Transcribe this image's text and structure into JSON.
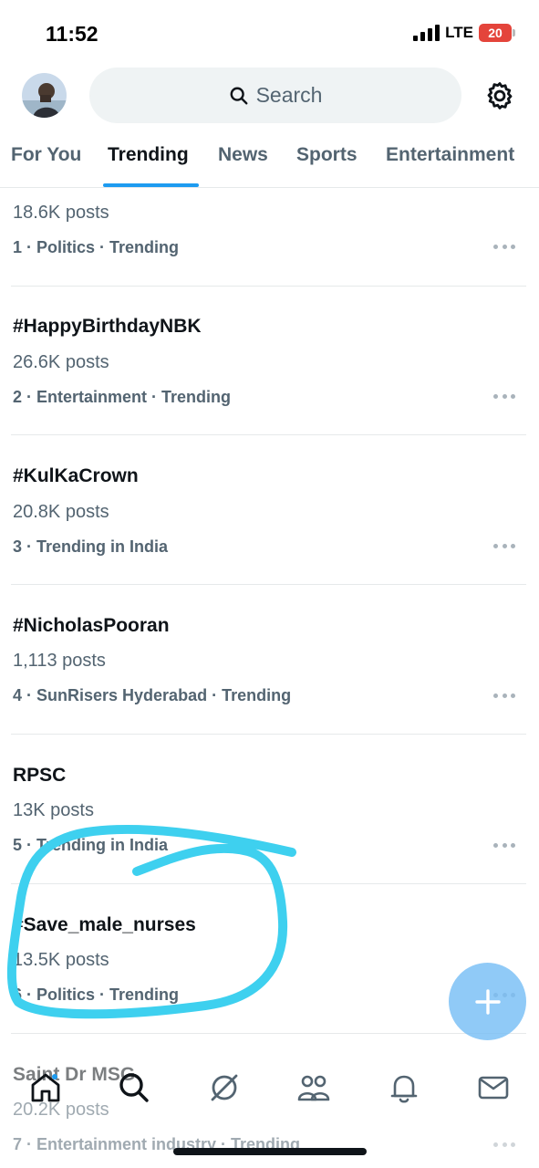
{
  "status_bar": {
    "time": "11:52",
    "network": "LTE",
    "battery": "20"
  },
  "header": {
    "avatar_icon": "user-avatar",
    "search_placeholder": "Search",
    "search_icon": "search-icon",
    "settings_icon": "gear-icon"
  },
  "tabs": [
    {
      "label": "For You",
      "active": false
    },
    {
      "label": "Trending",
      "active": true
    },
    {
      "label": "News",
      "active": false
    },
    {
      "label": "Sports",
      "active": false
    },
    {
      "label": "Entertainment",
      "active": false
    }
  ],
  "trends": [
    {
      "name": "",
      "posts": "18.6K posts",
      "meta": "1 · Politics · Trending"
    },
    {
      "name": "#HappyBirthdayNBK",
      "posts": "26.6K posts",
      "meta": "2 · Entertainment · Trending"
    },
    {
      "name": "#KulKaCrown",
      "posts": "20.8K posts",
      "meta": "3 · Trending in India"
    },
    {
      "name": "#NicholasPooran",
      "posts": "1,113 posts",
      "meta": "4 · SunRisers Hyderabad · Trending"
    },
    {
      "name": "RPSC",
      "posts": "13K posts",
      "meta": "5 · Trending in India"
    },
    {
      "name": "#Save_male_nurses",
      "posts": "13.5K posts",
      "meta": "6 · Politics · Trending"
    },
    {
      "name": "Saint Dr MSG",
      "posts": "20.2K posts",
      "meta": "7 · Entertainment industry · Trending"
    }
  ],
  "bottom_nav": [
    "home-icon",
    "search-icon",
    "grok-icon",
    "communities-icon",
    "notifications-bell-icon",
    "messages-icon"
  ],
  "fab": {
    "icon": "compose-plus-icon"
  },
  "colors": {
    "accent": "#1d9bf0",
    "annotation": "#3ed0ef",
    "battery": "#e4443b",
    "text_secondary": "#536471"
  }
}
